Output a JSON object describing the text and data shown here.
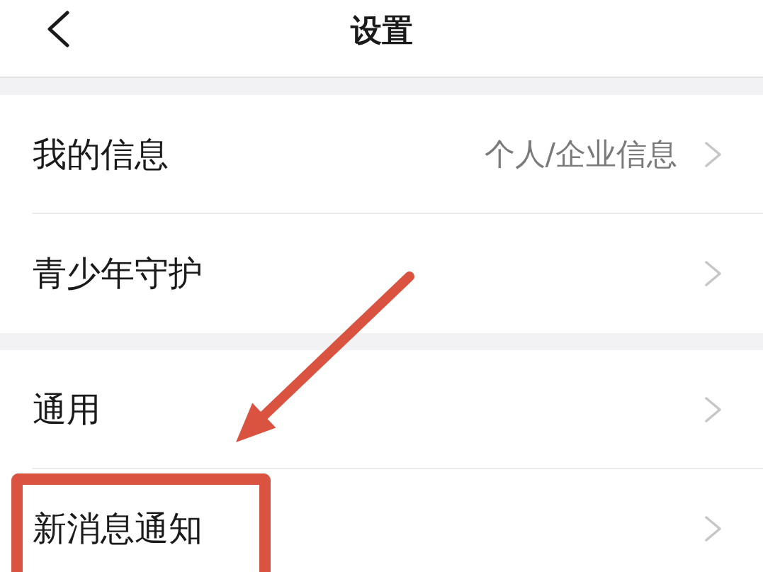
{
  "header": {
    "title": "设置"
  },
  "groups": [
    {
      "rows": [
        {
          "label": "我的信息",
          "value": "个人/企业信息",
          "highlighted": false
        },
        {
          "label": "青少年守护",
          "highlighted": false
        }
      ]
    },
    {
      "rows": [
        {
          "label": "通用",
          "highlighted": false
        },
        {
          "label": "新消息通知",
          "highlighted": true
        }
      ]
    }
  ]
}
